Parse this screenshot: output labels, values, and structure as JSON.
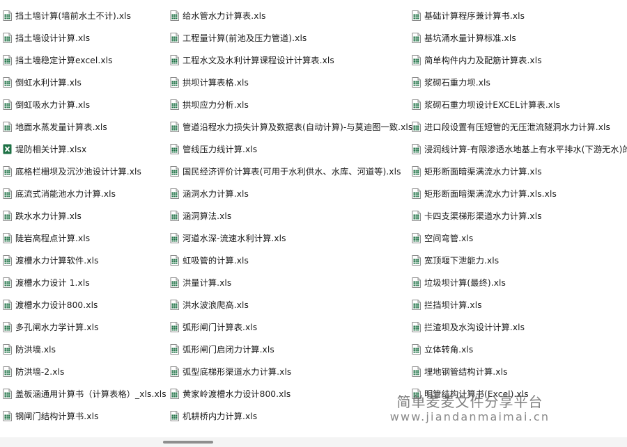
{
  "colors": {
    "excel_green": "#1e7145",
    "icon_line": "#3c8f5c",
    "text": "#1a1a1a"
  },
  "icons": {
    "xls": "excel-file-icon",
    "xlsx": "excel-x-file-icon"
  },
  "columns": [
    [
      {
        "name": "挡土墙计算(墙前水土不计).xls",
        "icon": "xls"
      },
      {
        "name": "挡土墙设计计算.xls",
        "icon": "xls"
      },
      {
        "name": "挡土墙稳定计算excel.xls",
        "icon": "xls"
      },
      {
        "name": "倒虹水利计算.xls",
        "icon": "xls"
      },
      {
        "name": "倒虹吸水力计算.xls",
        "icon": "xls"
      },
      {
        "name": "地面水蒸发量计算表.xls",
        "icon": "xls"
      },
      {
        "name": "堤防相关计算.xlsx",
        "icon": "xlsx"
      },
      {
        "name": "底格栏栅坝及沉沙池设计计算.xls",
        "icon": "xls"
      },
      {
        "name": "底流式消能池水力计算.xls",
        "icon": "xls"
      },
      {
        "name": "跌水水力计算.xls",
        "icon": "xls"
      },
      {
        "name": "陡岩高程点计算.xls",
        "icon": "xls"
      },
      {
        "name": "渡槽水力计算软件.xls",
        "icon": "xls"
      },
      {
        "name": "渡槽水力设计 1.xls",
        "icon": "xls"
      },
      {
        "name": "渡槽水力设计800.xls",
        "icon": "xls"
      },
      {
        "name": "多孔闸水力学计算.xls",
        "icon": "xls"
      },
      {
        "name": "防洪墙.xls",
        "icon": "xls"
      },
      {
        "name": "防洪墙-2.xls",
        "icon": "xls"
      },
      {
        "name": "盖板涵通用计算书（计算表格）_xls.xls",
        "icon": "xls"
      },
      {
        "name": "钢闸门结构计算书.xls",
        "icon": "xls"
      }
    ],
    [
      {
        "name": "给水管水力计算表.xls",
        "icon": "xls"
      },
      {
        "name": "工程量计算(前池及压力管道).xls",
        "icon": "xls"
      },
      {
        "name": "工程水文及水利计算课程设计计算表.xls",
        "icon": "xls"
      },
      {
        "name": "拱坝计算表格.xls",
        "icon": "xls"
      },
      {
        "name": "拱坝应力分析.xls",
        "icon": "xls"
      },
      {
        "name": "管道沿程水力损失计算及数据表(自动计算)-与莫迪图一致.xls",
        "icon": "xls"
      },
      {
        "name": "管线压力线计算.xls",
        "icon": "xls"
      },
      {
        "name": "国民经济评价计算表(可用于水利供水、水库、河道等).xls",
        "icon": "xls"
      },
      {
        "name": "涵洞水力计算.xls",
        "icon": "xls"
      },
      {
        "name": "涵洞算法.xls",
        "icon": "xls"
      },
      {
        "name": "河道水深-流速水利计算.xls",
        "icon": "xls"
      },
      {
        "name": "虹吸管的计算.xls",
        "icon": "xls"
      },
      {
        "name": "洪量计算.xls",
        "icon": "xls"
      },
      {
        "name": "洪水波浪爬高.xls",
        "icon": "xls"
      },
      {
        "name": "弧形闸门计算表.xls",
        "icon": "xls"
      },
      {
        "name": "弧形闸门启闭力计算.xls",
        "icon": "xls"
      },
      {
        "name": "弧型底梯形渠道水力计算.xls",
        "icon": "xls"
      },
      {
        "name": "黄家岭渡槽水力设计800.xls",
        "icon": "xls"
      },
      {
        "name": "机耕桥内力计算.xls",
        "icon": "xls"
      }
    ],
    [
      {
        "name": "基础计算程序兼计算书.xls",
        "icon": "xls"
      },
      {
        "name": "基坑涌水量计算标准.xls",
        "icon": "xls"
      },
      {
        "name": "简单构件内力及配筋计算表.xls",
        "icon": "xls"
      },
      {
        "name": "浆砌石重力坝.xls",
        "icon": "xls"
      },
      {
        "name": "浆砌石重力坝设计EXCEL计算表.xls",
        "icon": "xls"
      },
      {
        "name": "进口段设置有压短管的无压泄流隧洞水力计算.xls",
        "icon": "xls"
      },
      {
        "name": "浸润线计算-有限渗透水地基上有水平排水(下游无水)的均质坝.xls",
        "icon": "xls"
      },
      {
        "name": "矩形断面暗渠满流水力计算.xls",
        "icon": "xls"
      },
      {
        "name": "矩形断面暗渠满流水力计算.xls.xls",
        "icon": "xls"
      },
      {
        "name": "卡四支渠梯形渠道水力计算.xls",
        "icon": "xls"
      },
      {
        "name": "空间弯管.xls",
        "icon": "xls"
      },
      {
        "name": "宽顶堰下泄能力.xls",
        "icon": "xls"
      },
      {
        "name": "垃圾坝计算(最终).xls",
        "icon": "xls"
      },
      {
        "name": "拦挡坝计算.xls",
        "icon": "xls"
      },
      {
        "name": "拦渣坝及水沟设计计算.xls",
        "icon": "xls"
      },
      {
        "name": "立体转角.xls",
        "icon": "xls"
      },
      {
        "name": "埋地钢管结构计算.xls",
        "icon": "xls"
      },
      {
        "name": "明管结构计算书(Excel).xls",
        "icon": "xls"
      }
    ]
  ],
  "watermark": {
    "title": "简单麦麦文件分享平台",
    "url": "www.jiandanmaimai.cn"
  }
}
